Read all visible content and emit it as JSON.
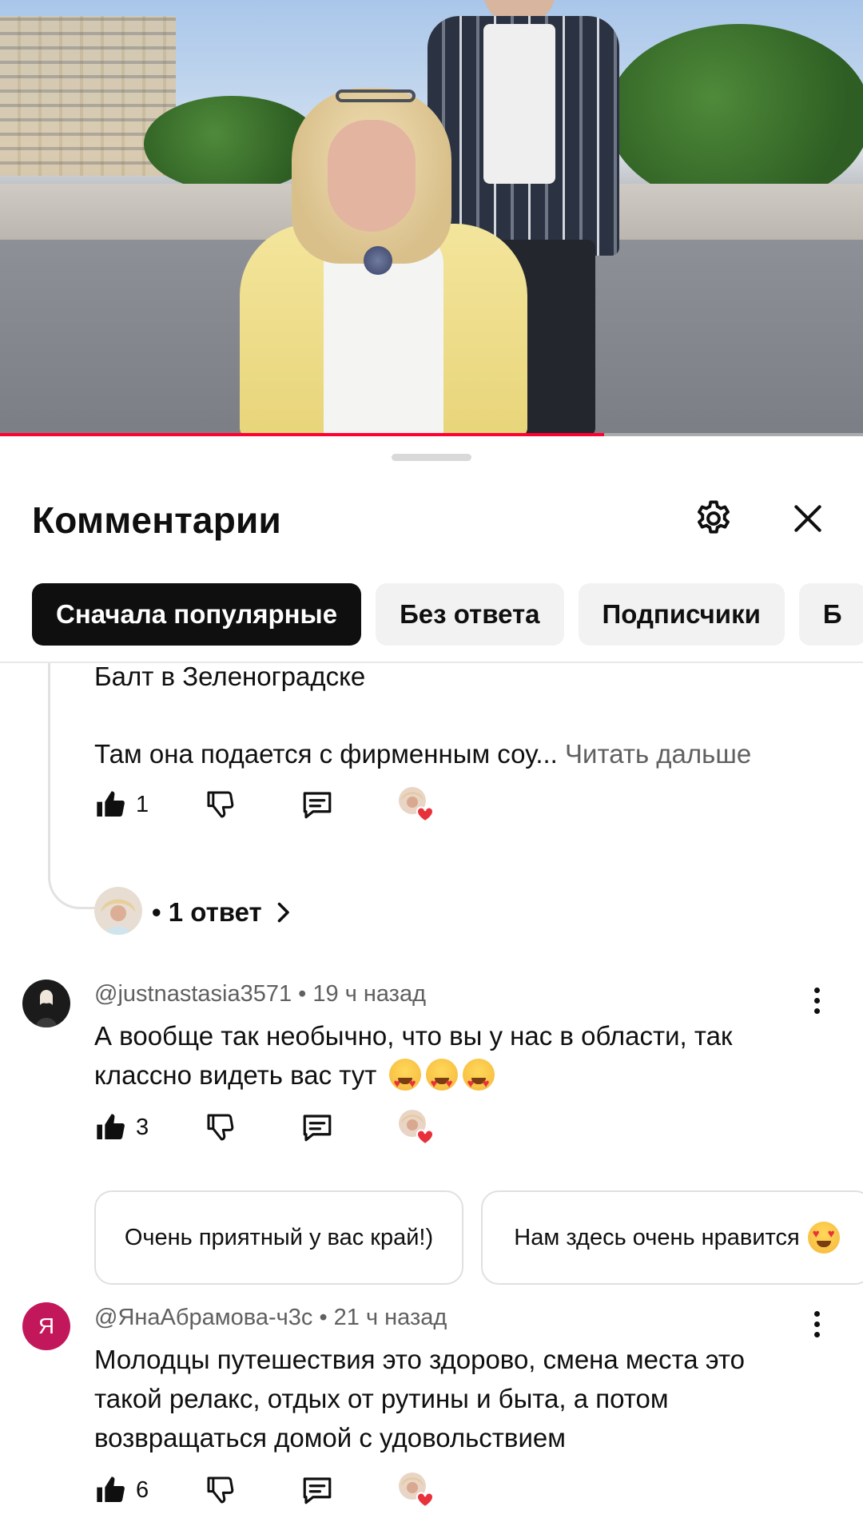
{
  "video": {
    "progress_fraction": 0.7,
    "colors": {
      "progress": "#ff0033"
    }
  },
  "comments_panel": {
    "title": "Комментарии",
    "settings_icon": "gear-icon",
    "close_icon": "close-icon",
    "filters": [
      {
        "label": "Сначала популярные",
        "active": true
      },
      {
        "label": "Без ответа",
        "active": false
      },
      {
        "label": "Подписчики",
        "active": false
      },
      {
        "label": "Б",
        "active": false
      }
    ]
  },
  "comments": [
    {
      "partial_text_line1": "Балт в Зеленоградске",
      "partial_text_line2": "Там она подается с фирменным соу...",
      "read_more": "Читать дальше",
      "likes": "1",
      "replies_label": "• 1 ответ"
    },
    {
      "author": "@justnastasia3571",
      "time": "• 19 ч назад",
      "text_line1": "А вообще так необычно, что вы у нас в области, так",
      "text_line2": "классно видеть вас тут",
      "likes": "3",
      "suggested_replies": [
        "Очень приятный у вас край!)",
        "Нам здесь очень нравится"
      ]
    },
    {
      "author": "@ЯнаАбрамова-ч3с",
      "avatar_letter": "Я",
      "avatar_color": "#c2185b",
      "time": "• 21 ч назад",
      "text_line1": "Молодцы путешествия это здорово, смена места это",
      "text_line2": "такой релакс, отдых от рутины и быта, а потом",
      "text_line3": "возвращаться домой с удовольствием",
      "likes": "6"
    }
  ]
}
